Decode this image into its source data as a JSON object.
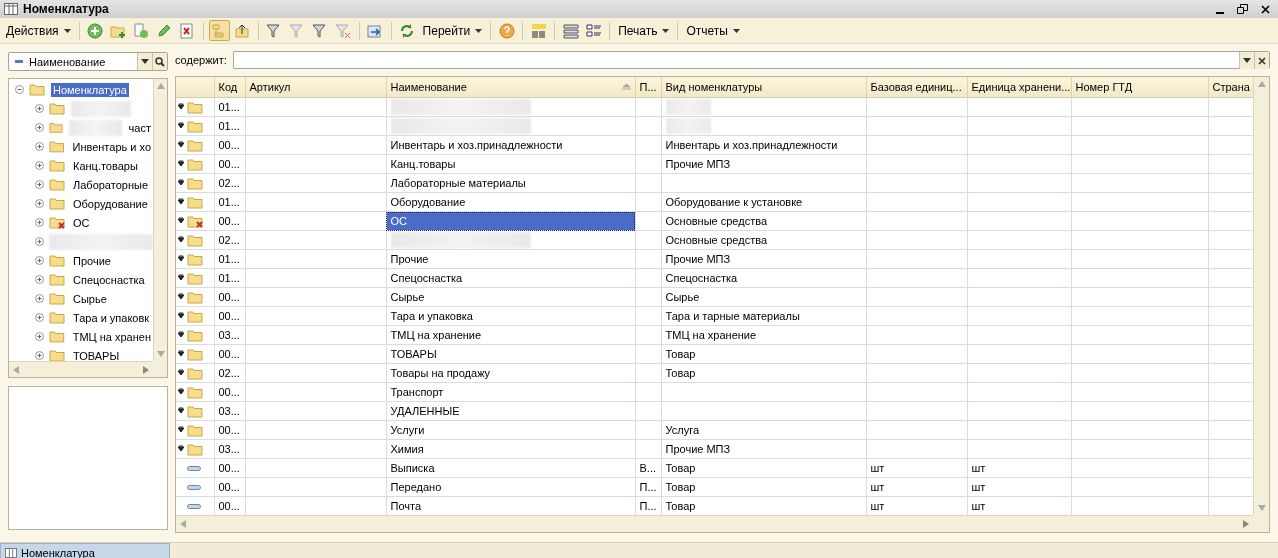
{
  "window": {
    "title": "Номенклатура"
  },
  "toolbar": {
    "actions_menu": "Действия",
    "goto_menu": "Перейти",
    "print_menu": "Печать",
    "reports_menu": "Отчеты"
  },
  "filter": {
    "field": "Наименование",
    "contains_label": "содержит:"
  },
  "tree": {
    "root": {
      "label": "Номенклатура",
      "expanded": true,
      "selected": true,
      "children": [
        {
          "kind": "blurred"
        },
        {
          "label": "част",
          "kind": "blurred"
        },
        {
          "label": "Инвентарь и хо",
          "kind": "folder"
        },
        {
          "label": "Канц.товары",
          "kind": "folder"
        },
        {
          "label": "Лабораторные",
          "kind": "folder"
        },
        {
          "label": "Оборудование",
          "kind": "folder"
        },
        {
          "label": "ОС",
          "kind": "deleted_folder"
        },
        {
          "kind": "hidden"
        },
        {
          "label": "Прочие",
          "kind": "folder"
        },
        {
          "label": "Спецоснастка",
          "kind": "folder"
        },
        {
          "label": "Сырье",
          "kind": "folder"
        },
        {
          "label": "Тара и упаковк",
          "kind": "folder"
        },
        {
          "label": "ТМЦ на хранен",
          "kind": "folder"
        },
        {
          "label": "ТОВАРЫ",
          "kind": "folder"
        }
      ]
    }
  },
  "table": {
    "columns": [
      "Код",
      "Артикул",
      "Наименование",
      "П...",
      "Вид номенклатуры",
      "Базовая единиц...",
      "Единица хранени...",
      "Номер ГТД",
      "Страна"
    ],
    "rows": [
      {
        "kind": "folder",
        "selected": false,
        "code": "01..."
      },
      {
        "kind": "folder",
        "selected": false,
        "code": "01..."
      },
      {
        "kind": "folder",
        "selected": false,
        "code": "00...",
        "name": "Инвентарь и хоз.принадлежности",
        "vid": "Инвентарь и хоз.принадлежности"
      },
      {
        "kind": "folder",
        "selected": false,
        "code": "00...",
        "name": "Канц.товары",
        "vid": "Прочие МПЗ"
      },
      {
        "kind": "folder",
        "selected": false,
        "code": "02...",
        "name": "Лабораторные материалы"
      },
      {
        "kind": "folder",
        "selected": false,
        "code": "01...",
        "name": "Оборудование",
        "vid": "Оборудование к установке"
      },
      {
        "kind": "deleted_folder",
        "selected": true,
        "code": "00...",
        "name": "ОС",
        "vid": "Основные средства"
      },
      {
        "kind": "folder",
        "selected": false,
        "code": "02...",
        "vid": "Основные средства"
      },
      {
        "kind": "folder",
        "selected": false,
        "code": "01...",
        "name": "Прочие",
        "vid": "Прочие МПЗ"
      },
      {
        "kind": "folder",
        "selected": false,
        "code": "01...",
        "name": "Спецоснастка",
        "vid": "Спецоснастка"
      },
      {
        "kind": "folder",
        "selected": false,
        "code": "00...",
        "name": "Сырье",
        "vid": "Сырье"
      },
      {
        "kind": "folder",
        "selected": false,
        "code": "00...",
        "name": "Тара и упаковка",
        "vid": "Тара и тарные материалы"
      },
      {
        "kind": "folder",
        "selected": false,
        "code": "03...",
        "name": "ТМЦ на хранение",
        "vid": "ТМЦ на хранение"
      },
      {
        "kind": "folder",
        "selected": false,
        "code": "00...",
        "name": "ТОВАРЫ",
        "vid": "Товар"
      },
      {
        "kind": "folder",
        "selected": false,
        "code": "02...",
        "name": "Товары на продажу",
        "vid": "Товар"
      },
      {
        "kind": "folder",
        "selected": false,
        "code": "00...",
        "name": "Транспорт"
      },
      {
        "kind": "folder",
        "selected": false,
        "code": "03...",
        "name": "УДАЛЕННЫЕ"
      },
      {
        "kind": "folder",
        "selected": false,
        "code": "00...",
        "name": "Услуги",
        "vid": "Услуга"
      },
      {
        "kind": "folder",
        "selected": false,
        "code": "03...",
        "name": "Химия",
        "vid": "Прочие МПЗ"
      },
      {
        "kind": "item",
        "selected": false,
        "code": "00...",
        "name": "Выписка",
        "p": "В...",
        "vid": "Товар",
        "base": "шт",
        "store": "шт"
      },
      {
        "kind": "item",
        "selected": false,
        "code": "00...",
        "name": "Передано",
        "p": "П...",
        "vid": "Товар",
        "base": "шт",
        "store": "шт"
      },
      {
        "kind": "item",
        "selected": false,
        "code": "00...",
        "name": "Почта",
        "p": "П...",
        "vid": "Товар",
        "base": "шт",
        "store": "шт"
      }
    ]
  },
  "taskbar": {
    "items": [
      {
        "label": "Номенклатура",
        "selected": true
      }
    ]
  }
}
